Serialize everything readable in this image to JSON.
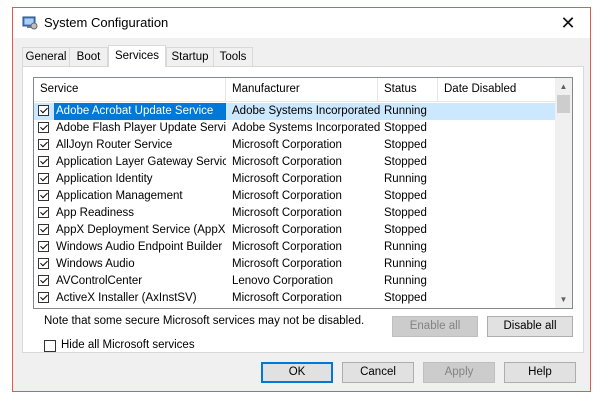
{
  "window": {
    "title": "System Configuration",
    "close_glyph": "✕",
    "accent_border": "#e05a4f",
    "icon": "system-config-icon"
  },
  "tabs": [
    {
      "label": "General",
      "active": false
    },
    {
      "label": "Boot",
      "active": false
    },
    {
      "label": "Services",
      "active": true
    },
    {
      "label": "Startup",
      "active": false
    },
    {
      "label": "Tools",
      "active": false
    }
  ],
  "services_table": {
    "columns": [
      "Service",
      "Manufacturer",
      "Status",
      "Date Disabled"
    ],
    "rows": [
      {
        "name": "Adobe Acrobat Update Service",
        "manufacturer": "Adobe Systems Incorporated",
        "status": "Running",
        "date_disabled": "",
        "checked": true,
        "selected": true
      },
      {
        "name": "Adobe Flash Player Update Service",
        "manufacturer": "Adobe Systems Incorporated",
        "status": "Stopped",
        "date_disabled": "",
        "checked": true
      },
      {
        "name": "AllJoyn Router Service",
        "manufacturer": "Microsoft Corporation",
        "status": "Stopped",
        "date_disabled": "",
        "checked": true
      },
      {
        "name": "Application Layer Gateway Service",
        "manufacturer": "Microsoft Corporation",
        "status": "Stopped",
        "date_disabled": "",
        "checked": true
      },
      {
        "name": "Application Identity",
        "manufacturer": "Microsoft Corporation",
        "status": "Running",
        "date_disabled": "",
        "checked": true
      },
      {
        "name": "Application Management",
        "manufacturer": "Microsoft Corporation",
        "status": "Stopped",
        "date_disabled": "",
        "checked": true
      },
      {
        "name": "App Readiness",
        "manufacturer": "Microsoft Corporation",
        "status": "Stopped",
        "date_disabled": "",
        "checked": true
      },
      {
        "name": "AppX Deployment Service (AppX...",
        "manufacturer": "Microsoft Corporation",
        "status": "Stopped",
        "date_disabled": "",
        "checked": true
      },
      {
        "name": "Windows Audio Endpoint Builder",
        "manufacturer": "Microsoft Corporation",
        "status": "Running",
        "date_disabled": "",
        "checked": true
      },
      {
        "name": "Windows Audio",
        "manufacturer": "Microsoft Corporation",
        "status": "Running",
        "date_disabled": "",
        "checked": true
      },
      {
        "name": "AVControlCenter",
        "manufacturer": "Lenovo Corporation",
        "status": "Running",
        "date_disabled": "",
        "checked": true
      },
      {
        "name": "ActiveX Installer (AxInstSV)",
        "manufacturer": "Microsoft Corporation",
        "status": "Stopped",
        "date_disabled": "",
        "checked": true
      }
    ]
  },
  "note": "Note that some secure Microsoft services may not be disabled.",
  "enable_all": {
    "label": "Enable all",
    "disabled": true
  },
  "disable_all": {
    "label": "Disable all",
    "disabled": false
  },
  "hide_ms": {
    "label": "Hide all Microsoft services",
    "checked": false
  },
  "footer": {
    "ok": "OK",
    "cancel": "Cancel",
    "apply": "Apply",
    "help": "Help"
  }
}
